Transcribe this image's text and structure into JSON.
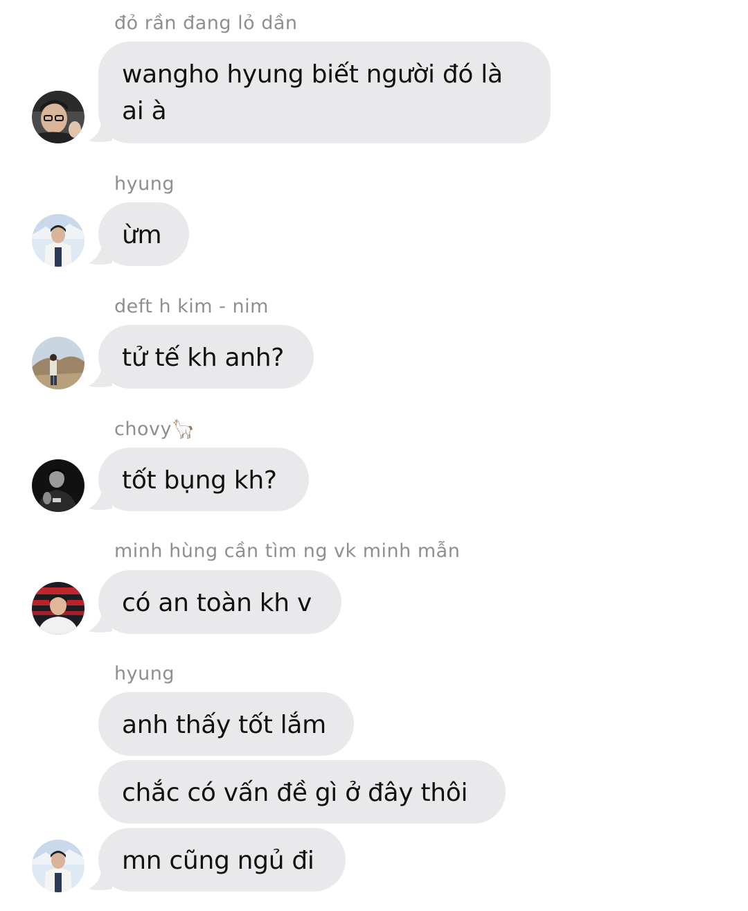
{
  "messages": [
    {
      "sender": "đỏ rần đang lỏ dần",
      "text": "wangho hyung biết người đó là ai à",
      "avatar": "avatar-glasses-icon"
    },
    {
      "sender": "hyung",
      "text": "ừm",
      "avatar": "avatar-snow-icon"
    },
    {
      "sender": "deft h kim - nim",
      "text": "tử tế kh anh?",
      "avatar": "avatar-landscape-icon"
    },
    {
      "sender": "chovy🦙",
      "text": "tốt bụng kh?",
      "avatar": "avatar-dark-icon"
    },
    {
      "sender": "minh hùng cần tìm ng vk minh mẫn",
      "text": "có an toàn kh v",
      "avatar": "avatar-stage-icon"
    },
    {
      "sender": "hyung",
      "texts": [
        "anh thấy tốt lắm",
        "chắc có vấn đề gì ở đây thôi",
        "mn cũng ngủ đi"
      ],
      "avatar": "avatar-snow-icon"
    }
  ],
  "colors": {
    "bubble": "#e9e9eb",
    "sender": "#8e8e93",
    "text": "#111111"
  }
}
